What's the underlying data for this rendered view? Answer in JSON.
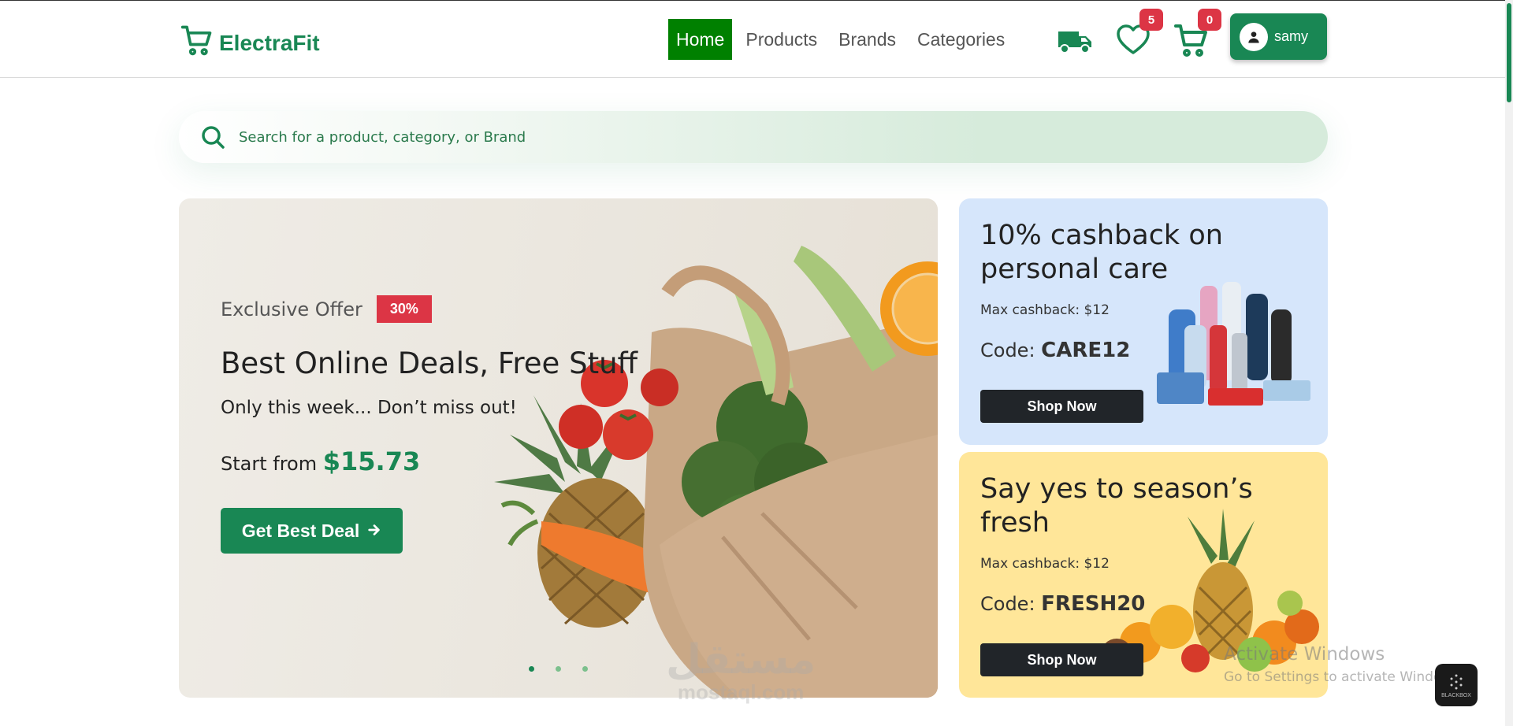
{
  "app": {
    "brand_name": "ElectraFit",
    "brand_color": "#198754"
  },
  "nav": {
    "links": [
      "Home",
      "Products",
      "Brands",
      "Categories"
    ],
    "active": "Home",
    "wishlist_count": "5",
    "cart_count": "0",
    "user_name": "samy"
  },
  "search": {
    "placeholder": "Search for a product, category, or Brand"
  },
  "hero": {
    "offer_label": "Exclusive Offer",
    "offer_badge": "30%",
    "title": "Best Online Deals, Free Stuff",
    "subtitle": "Only this week... Don’t miss out!",
    "price_prefix": "Start from",
    "price": "$15.73",
    "cta": "Get Best Deal",
    "slides": 3,
    "active_slide": 1
  },
  "promos": [
    {
      "title": "10% cashback on personal care",
      "max": "Max cashback: $12",
      "code_label": "Code:",
      "code": "CARE12",
      "cta": "Shop Now",
      "bg": "#d6e6fb"
    },
    {
      "title": "Say yes to season’s fresh",
      "max": "Max cashback: $12",
      "code_label": "Code:",
      "code": "FRESH20",
      "cta": "Shop Now",
      "bg": "#ffe699"
    }
  ],
  "overlays": {
    "watermark_ar": "مستقل",
    "watermark_en": "mostaql.com",
    "activate_title": "Activate Windows",
    "activate_sub": "Go to Settings to activate Windows.",
    "blackbox_label": "BLACKBOX"
  }
}
